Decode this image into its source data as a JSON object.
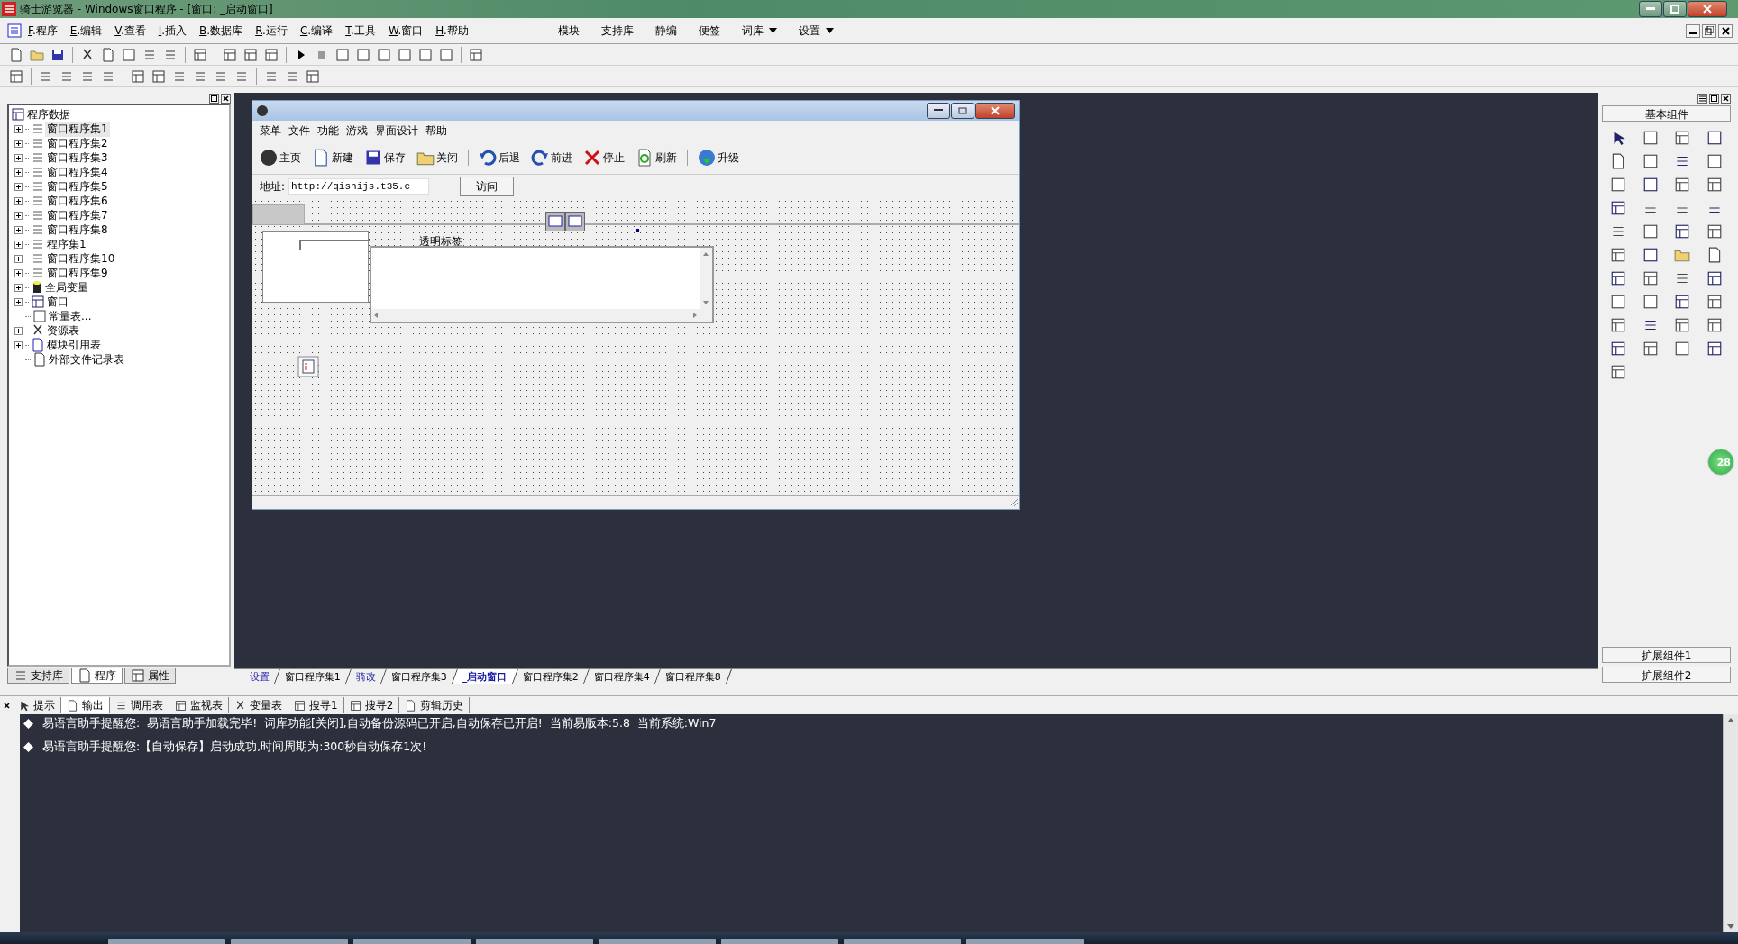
{
  "window": {
    "title": "骑士游览器 - Windows窗口程序 - [窗口: _启动窗口]"
  },
  "menu": [
    {
      "label": "F.程序"
    },
    {
      "label": "E.编辑"
    },
    {
      "label": "V.查看"
    },
    {
      "label": "I.插入"
    },
    {
      "label": "B.数据库"
    },
    {
      "label": "R.运行"
    },
    {
      "label": "C.编译"
    },
    {
      "label": "T.工具"
    },
    {
      "label": "W.窗口"
    },
    {
      "label": "H.帮助"
    }
  ],
  "extra_menu": [
    {
      "label": "模块",
      "dropdown": false
    },
    {
      "label": "支持库",
      "dropdown": false
    },
    {
      "label": "静编",
      "dropdown": false
    },
    {
      "label": "便签",
      "dropdown": false
    },
    {
      "label": "词库",
      "dropdown": true
    },
    {
      "label": "设置",
      "dropdown": true
    }
  ],
  "tree": {
    "root": "程序数据",
    "items": [
      {
        "label": "窗口程序集1",
        "kind": "module",
        "expandable": true,
        "selected": true
      },
      {
        "label": "窗口程序集2",
        "kind": "module",
        "expandable": true,
        "selected": false
      },
      {
        "label": "窗口程序集3",
        "kind": "module",
        "expandable": true,
        "selected": false
      },
      {
        "label": "窗口程序集4",
        "kind": "module",
        "expandable": true,
        "selected": false
      },
      {
        "label": "窗口程序集5",
        "kind": "module",
        "expandable": true,
        "selected": false
      },
      {
        "label": "窗口程序集6",
        "kind": "module",
        "expandable": true,
        "selected": false
      },
      {
        "label": "窗口程序集7",
        "kind": "module",
        "expandable": true,
        "selected": false
      },
      {
        "label": "窗口程序集8",
        "kind": "module",
        "expandable": true,
        "selected": false
      },
      {
        "label": "程序集1",
        "kind": "module",
        "expandable": true,
        "selected": false
      },
      {
        "label": "窗口程序集10",
        "kind": "module",
        "expandable": true,
        "selected": false
      },
      {
        "label": "窗口程序集9",
        "kind": "module",
        "expandable": true,
        "selected": false
      },
      {
        "label": "全局变量",
        "kind": "variable",
        "expandable": true,
        "selected": false
      },
      {
        "label": "窗口",
        "kind": "window",
        "expandable": true,
        "selected": false
      },
      {
        "label": "常量表...",
        "kind": "constants",
        "expandable": false,
        "selected": false
      },
      {
        "label": "资源表",
        "kind": "resources",
        "expandable": true,
        "selected": false
      },
      {
        "label": "模块引用表",
        "kind": "reference",
        "expandable": true,
        "selected": false
      },
      {
        "label": "外部文件记录表",
        "kind": "file",
        "expandable": false,
        "selected": false
      }
    ]
  },
  "left_tabs": [
    {
      "label": "支持库",
      "selected": false
    },
    {
      "label": "程序",
      "selected": true
    },
    {
      "label": "属性",
      "selected": false
    }
  ],
  "designer": {
    "menu": [
      "菜单",
      "文件",
      "功能",
      "游戏",
      "界面设计",
      "帮助"
    ],
    "toolbar": [
      {
        "label": "主页"
      },
      {
        "label": "新建"
      },
      {
        "label": "保存"
      },
      {
        "label": "关闭"
      },
      {
        "label": "后退"
      },
      {
        "label": "前进"
      },
      {
        "label": "停止"
      },
      {
        "label": "刷新"
      },
      {
        "label": "升级"
      }
    ],
    "address_label": "地址:",
    "address_value": "http://qishijs.t35.c",
    "go_button": "访问",
    "transparent_label": "透明标签"
  },
  "doc_tabs": [
    {
      "label": "设置",
      "selected": false,
      "modified": true
    },
    {
      "label": "窗口程序集1",
      "selected": false,
      "modified": false
    },
    {
      "label": "骑改",
      "selected": false,
      "modified": true
    },
    {
      "label": "窗口程序集3",
      "selected": false,
      "modified": false
    },
    {
      "label": "_启动窗口",
      "selected": true,
      "modified": false
    },
    {
      "label": "窗口程序集2",
      "selected": false,
      "modified": false
    },
    {
      "label": "窗口程序集4",
      "selected": false,
      "modified": false
    },
    {
      "label": "窗口程序集8",
      "selected": false,
      "modified": false
    }
  ],
  "palette": {
    "title": "基本组件",
    "groups": [
      "扩展组件1",
      "扩展组件2"
    ]
  },
  "floating_badge": "28",
  "output_tabs": [
    {
      "label": "提示",
      "selected": false
    },
    {
      "label": "输出",
      "selected": true
    },
    {
      "label": "调用表",
      "selected": false
    },
    {
      "label": "监视表",
      "selected": false
    },
    {
      "label": "变量表",
      "selected": false
    },
    {
      "label": "搜寻1",
      "selected": false
    },
    {
      "label": "搜寻2",
      "selected": false
    },
    {
      "label": "剪辑历史",
      "selected": false
    }
  ],
  "messages": [
    "易语言助手提醒您:  易语言助手加载完毕!  词库功能[关闭],自动备份源码已开启,自动保存已开启!  当前易版本:5.8  当前系统:Win7",
    "易语言助手提醒您:【自动保存】启动成功,时间周期为:300秒自动保存1次!"
  ]
}
